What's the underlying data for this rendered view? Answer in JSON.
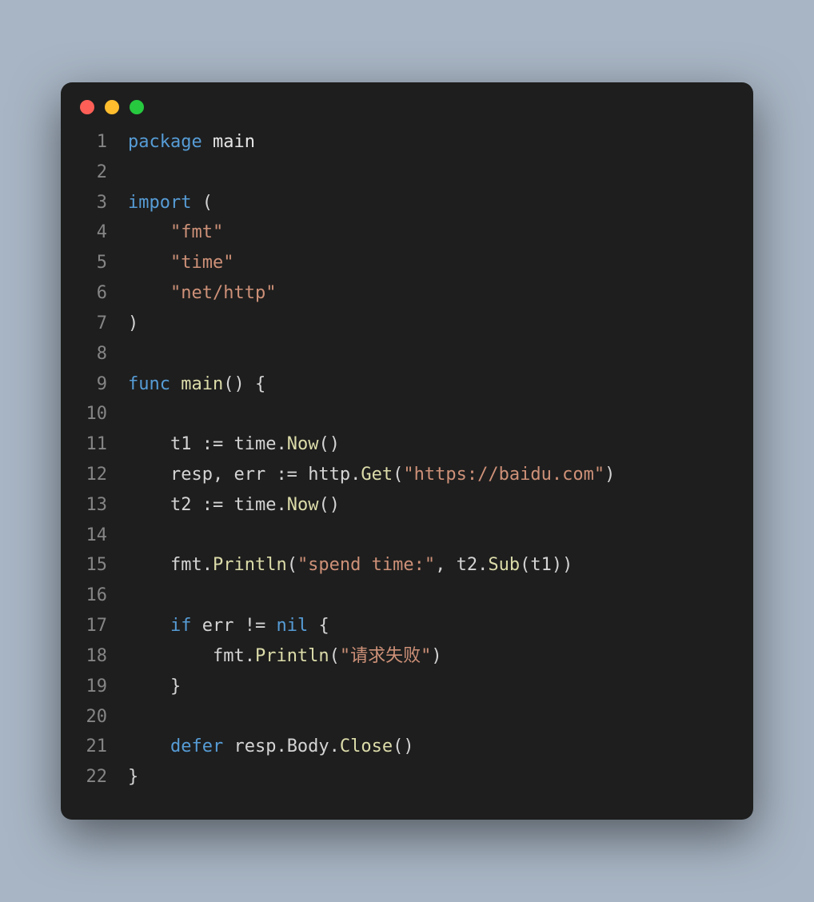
{
  "window": {
    "dots": [
      "red",
      "yellow",
      "green"
    ]
  },
  "code": {
    "lines": [
      {
        "n": "1",
        "tokens": [
          {
            "c": "kw",
            "t": "package"
          },
          {
            "c": "white",
            "t": " main"
          }
        ]
      },
      {
        "n": "2",
        "tokens": []
      },
      {
        "n": "3",
        "tokens": [
          {
            "c": "kw",
            "t": "import"
          },
          {
            "c": "paren",
            "t": " ("
          }
        ]
      },
      {
        "n": "4",
        "tokens": [
          {
            "c": "ident",
            "t": "    "
          },
          {
            "c": "str",
            "t": "\"fmt\""
          }
        ]
      },
      {
        "n": "5",
        "tokens": [
          {
            "c": "ident",
            "t": "    "
          },
          {
            "c": "str",
            "t": "\"time\""
          }
        ]
      },
      {
        "n": "6",
        "tokens": [
          {
            "c": "ident",
            "t": "    "
          },
          {
            "c": "str",
            "t": "\"net/http\""
          }
        ]
      },
      {
        "n": "7",
        "tokens": [
          {
            "c": "paren",
            "t": ")"
          }
        ]
      },
      {
        "n": "8",
        "tokens": []
      },
      {
        "n": "9",
        "tokens": [
          {
            "c": "kw",
            "t": "func"
          },
          {
            "c": "fn",
            "t": " main"
          },
          {
            "c": "paren",
            "t": "() {"
          }
        ]
      },
      {
        "n": "10",
        "tokens": []
      },
      {
        "n": "11",
        "tokens": [
          {
            "c": "ident",
            "t": "    t1 "
          },
          {
            "c": "op",
            "t": ":= "
          },
          {
            "c": "ident",
            "t": "time."
          },
          {
            "c": "fn",
            "t": "Now"
          },
          {
            "c": "paren",
            "t": "()"
          }
        ]
      },
      {
        "n": "12",
        "tokens": [
          {
            "c": "ident",
            "t": "    resp, err "
          },
          {
            "c": "op",
            "t": ":= "
          },
          {
            "c": "ident",
            "t": "http."
          },
          {
            "c": "fn",
            "t": "Get"
          },
          {
            "c": "paren",
            "t": "("
          },
          {
            "c": "str",
            "t": "\"https://baidu.com\""
          },
          {
            "c": "paren",
            "t": ")"
          }
        ]
      },
      {
        "n": "13",
        "tokens": [
          {
            "c": "ident",
            "t": "    t2 "
          },
          {
            "c": "op",
            "t": ":= "
          },
          {
            "c": "ident",
            "t": "time."
          },
          {
            "c": "fn",
            "t": "Now"
          },
          {
            "c": "paren",
            "t": "()"
          }
        ]
      },
      {
        "n": "14",
        "tokens": []
      },
      {
        "n": "15",
        "tokens": [
          {
            "c": "ident",
            "t": "    fmt."
          },
          {
            "c": "fn",
            "t": "Println"
          },
          {
            "c": "paren",
            "t": "("
          },
          {
            "c": "str",
            "t": "\"spend time:\""
          },
          {
            "c": "ident",
            "t": ", t2."
          },
          {
            "c": "fn",
            "t": "Sub"
          },
          {
            "c": "paren",
            "t": "(t1))"
          }
        ]
      },
      {
        "n": "16",
        "tokens": []
      },
      {
        "n": "17",
        "tokens": [
          {
            "c": "ident",
            "t": "    "
          },
          {
            "c": "kw",
            "t": "if"
          },
          {
            "c": "ident",
            "t": " err "
          },
          {
            "c": "op",
            "t": "!= "
          },
          {
            "c": "nil",
            "t": "nil"
          },
          {
            "c": "paren",
            "t": " {"
          }
        ]
      },
      {
        "n": "18",
        "tokens": [
          {
            "c": "ident",
            "t": "        fmt."
          },
          {
            "c": "fn",
            "t": "Println"
          },
          {
            "c": "paren",
            "t": "("
          },
          {
            "c": "str",
            "t": "\"请求失败\""
          },
          {
            "c": "paren",
            "t": ")"
          }
        ]
      },
      {
        "n": "19",
        "tokens": [
          {
            "c": "ident",
            "t": "    "
          },
          {
            "c": "paren",
            "t": "}"
          }
        ]
      },
      {
        "n": "20",
        "tokens": []
      },
      {
        "n": "21",
        "tokens": [
          {
            "c": "ident",
            "t": "    "
          },
          {
            "c": "kw",
            "t": "defer"
          },
          {
            "c": "ident",
            "t": " resp.Body."
          },
          {
            "c": "fn",
            "t": "Close"
          },
          {
            "c": "paren",
            "t": "()"
          }
        ]
      },
      {
        "n": "22",
        "tokens": [
          {
            "c": "paren",
            "t": "}"
          }
        ]
      }
    ]
  }
}
